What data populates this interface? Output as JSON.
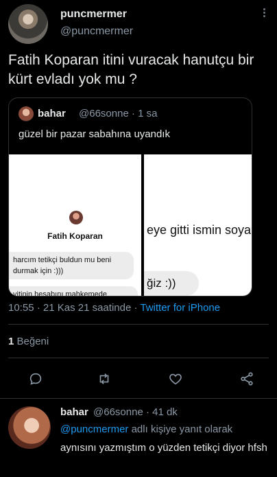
{
  "tweet": {
    "author_name": "puncmermer",
    "author_handle": "@puncmermer",
    "text": "Fatih Koparan itini vuracak hanutçu bir kürt evladı yok mu ?",
    "timestamp": "10:55 · 21 Kas 21 saatinde ·",
    "source": "Twitter for iPhone",
    "likes_count": "1",
    "likes_label": "Beğeni"
  },
  "quote": {
    "author_name": "bahar",
    "author_handle": "@66sonne · 1 sa",
    "text": "güzel bir pazar sabahına uyandık",
    "media": {
      "contact_name": "Fatih Koparan",
      "bubble_1": "harcım tetikçi buldun mu beni durmak için :)))",
      "bubble_2": "vitinin hesabını mahkemede eceksin ve hayatın boyunca şına çıkacak",
      "right_text": "eye gitti ismin soya",
      "right_bubble": "ğiz :))"
    }
  },
  "actions": {
    "reply": "reply-icon",
    "retweet": "retweet-icon",
    "like": "heart-icon",
    "share": "share-icon"
  },
  "reply": {
    "author_name": "bahar",
    "author_handle": "@66sonne · 41 dk",
    "mention": "@puncmermer",
    "reply_suffix": " adlı kişiye yanıt olarak",
    "text": "aynısını yazmıştım o yüzden tetikçi diyor hfsh"
  },
  "colors": {
    "background": "#000000",
    "link": "#1d9bf0",
    "secondary_text": "#8b98a5",
    "divider": "#2f3336"
  }
}
